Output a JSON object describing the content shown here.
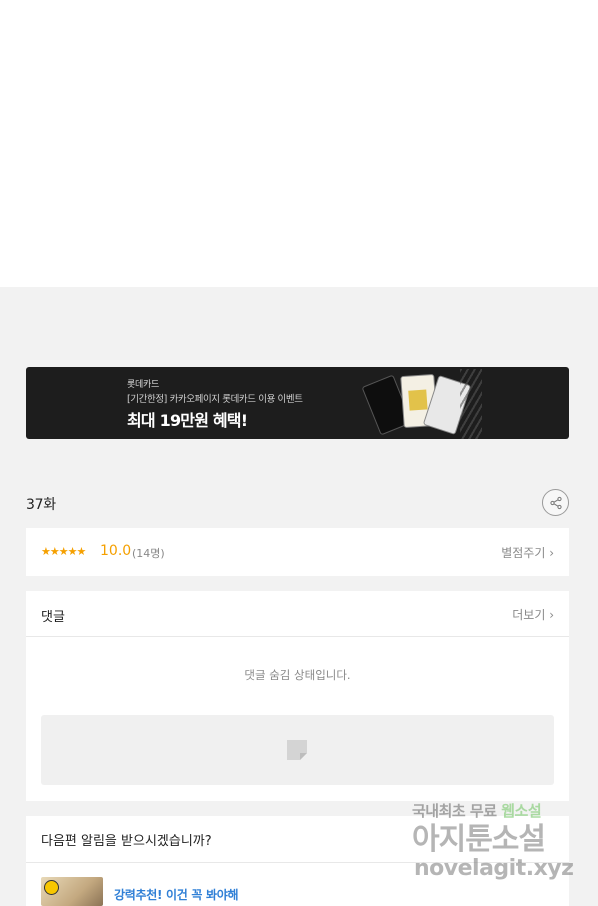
{
  "banner": {
    "brand": "롯데카드",
    "subtitle": "[기간한정] 카카오페이지 롯데카드 이용 이벤트",
    "headline": "최대 19만원 혜택!"
  },
  "episode": {
    "title": "37화"
  },
  "rating": {
    "stars": "★★★★★",
    "score": "10.0",
    "count": "(14명)",
    "rate_link": "별점주기 ›"
  },
  "comments": {
    "title": "댓글",
    "more_link": "더보기 ›",
    "hidden_message": "댓글 숨김 상태입니다."
  },
  "notify": {
    "question": "다음편 알림을 받으시겠습니까?",
    "recommendation": "강력추천! 이건 꼭 봐야해"
  },
  "watermark": {
    "line1_a": "국내최초 무료 ",
    "line1_b": "웹소설",
    "line2": "아지툰소설",
    "line3": "novelagit.xyz"
  },
  "colors": {
    "accent_star": "#f5a000",
    "link_blue": "#2f7fd6",
    "banner_bg": "#1d1d1d",
    "page_bg": "#f2f2f2"
  },
  "icons": {
    "share": "share-icon",
    "ad_placeholder": "image-placeholder-icon",
    "clock": "clock-icon"
  }
}
